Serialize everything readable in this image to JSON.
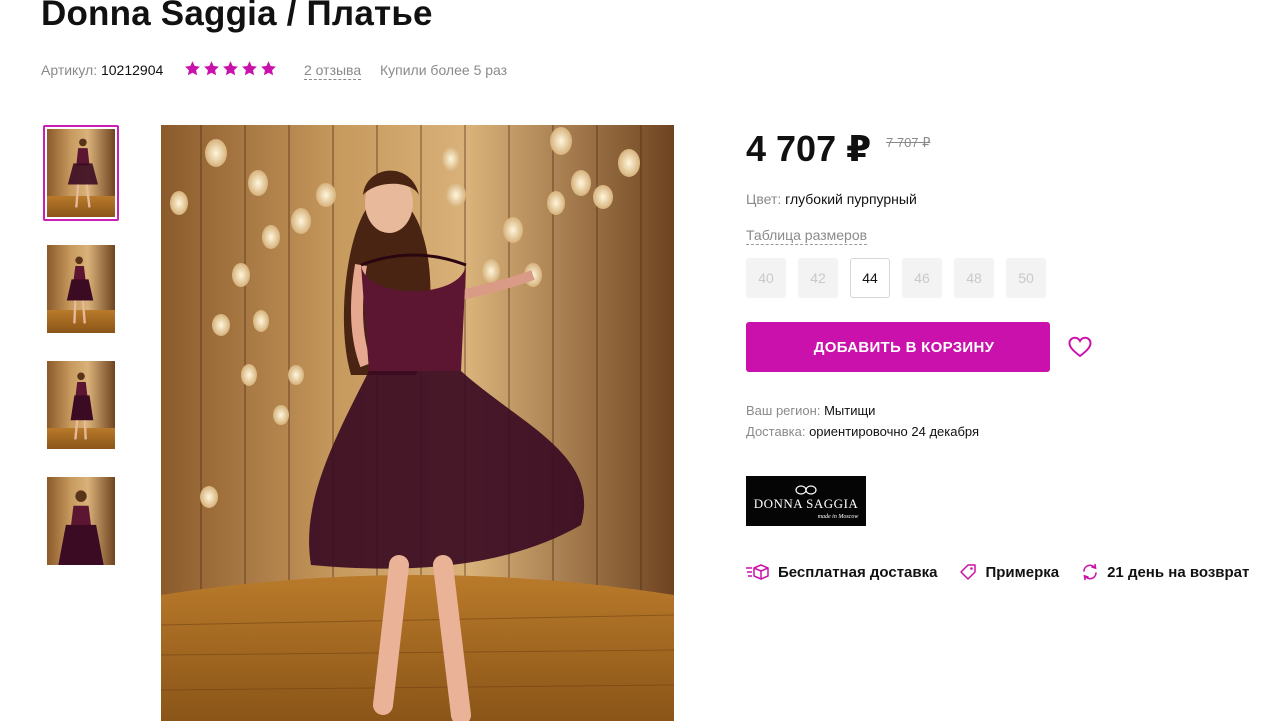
{
  "product": {
    "title": "Donna Saggia / Платье",
    "article_label": "Артикул:",
    "article_value": "10212904",
    "rating": 5,
    "reviews": "2 отзыва",
    "bought": "Купили более 5 раз"
  },
  "price": {
    "current": "4 707 ₽",
    "old": "7 707 ₽"
  },
  "color": {
    "label": "Цвет:",
    "value": "глубокий пурпурный"
  },
  "size_table_link": "Таблица размеров",
  "sizes": [
    {
      "label": "40",
      "available": false
    },
    {
      "label": "42",
      "available": false
    },
    {
      "label": "44",
      "available": true,
      "selected": true
    },
    {
      "label": "46",
      "available": false
    },
    {
      "label": "48",
      "available": false
    },
    {
      "label": "50",
      "available": false
    }
  ],
  "cart_button": "ДОБАВИТЬ В КОРЗИНУ",
  "region": {
    "label": "Ваш регион:",
    "value": "Мытищи"
  },
  "delivery": {
    "label": "Доставка:",
    "value": "ориентировочно 24 декабря"
  },
  "brand": {
    "name": "DONNA SAGGIA",
    "tagline": "made in Moscow"
  },
  "features": [
    {
      "icon": "delivery-box-icon",
      "label": "Бесплатная доставка"
    },
    {
      "icon": "tag-icon",
      "label": "Примерка"
    },
    {
      "icon": "return-arrows-icon",
      "label": "21 день на возврат"
    }
  ],
  "thumbnails": [
    "photo-1",
    "photo-2",
    "photo-3",
    "photo-4"
  ],
  "colors": {
    "accent": "#cb11ab",
    "text": "#111111",
    "muted": "#8a8a8a"
  }
}
